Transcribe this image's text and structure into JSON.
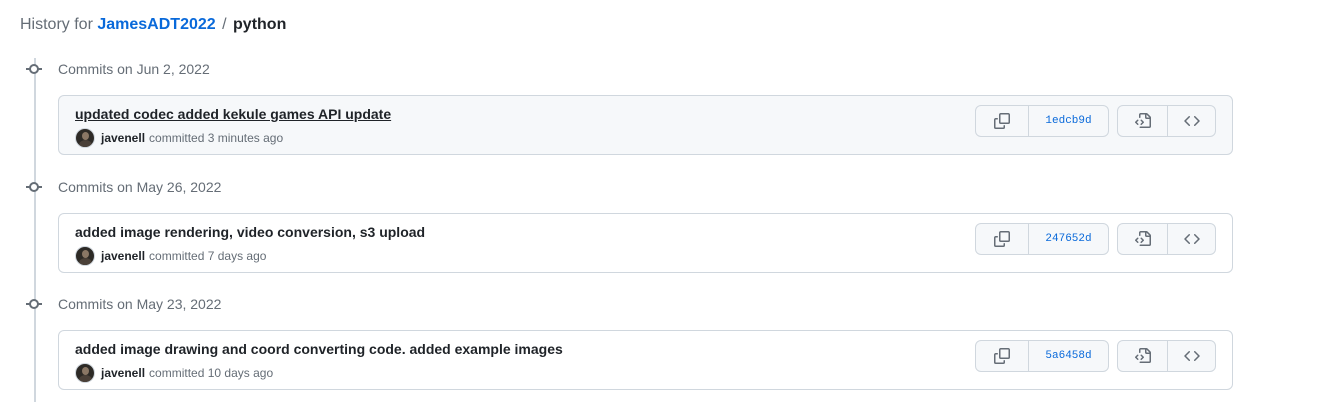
{
  "header": {
    "prefix": "History for",
    "owner": "JamesADT2022",
    "separator": "/",
    "path": "python"
  },
  "groups": [
    {
      "title": "Commits on Jun 2, 2022",
      "commit": {
        "message": "updated codec added kekule games API update",
        "author": "javenell",
        "action": "committed",
        "time": "3 minutes ago",
        "sha": "1edcb9d"
      }
    },
    {
      "title": "Commits on May 26, 2022",
      "commit": {
        "message": "added image rendering, video conversion, s3 upload",
        "author": "javenell",
        "action": "committed",
        "time": "7 days ago",
        "sha": "247652d"
      }
    },
    {
      "title": "Commits on May 23, 2022",
      "commit": {
        "message": "added image drawing and coord converting code. added example images",
        "author": "javenell",
        "action": "committed",
        "time": "10 days ago",
        "sha": "5a6458d"
      }
    }
  ],
  "icons": {
    "commit_node": "git-commit-icon",
    "copy": "copy-icon",
    "browse": "file-code-icon",
    "code": "code-icon"
  },
  "colors": {
    "link": "#0969da",
    "muted": "#656d76",
    "border": "#d0d7de",
    "subtle_bg": "#f6f8fa"
  }
}
